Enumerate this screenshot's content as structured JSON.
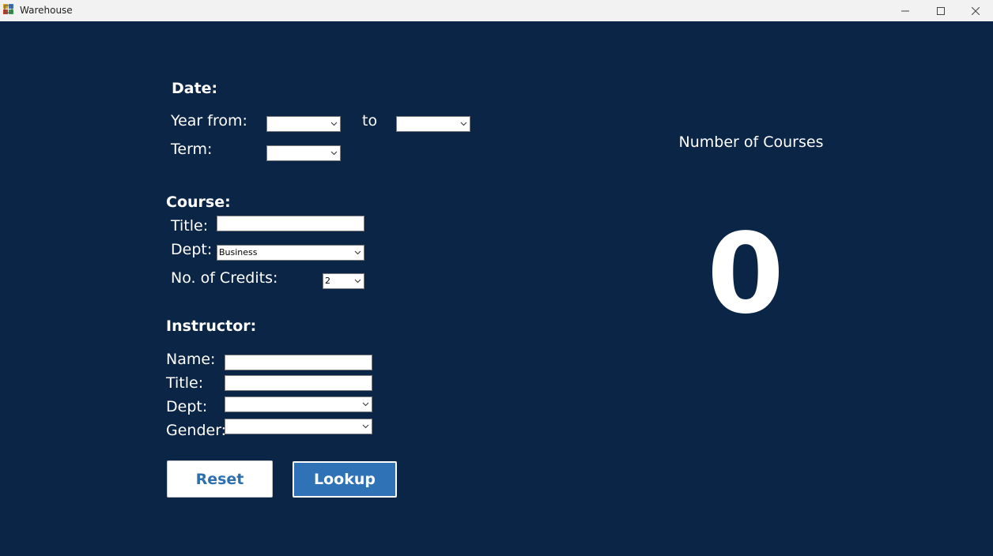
{
  "window": {
    "title": "Warehouse"
  },
  "date": {
    "section_label": "Date:",
    "year_from_label": "Year from:",
    "year_from_value": "",
    "to_label": "to",
    "year_to_value": "",
    "term_label": "Term:",
    "term_value": ""
  },
  "course": {
    "section_label": "Course:",
    "title_label": "Title:",
    "title_value": "",
    "dept_label": "Dept:",
    "dept_value": "Business",
    "credits_label": "No. of Credits:",
    "credits_value": "2"
  },
  "instructor": {
    "section_label": "Instructor:",
    "name_label": "Name:",
    "name_value": "",
    "title_label": "Title:",
    "title_value": "",
    "dept_label": "Dept:",
    "dept_value": "",
    "gender_label": "Gender:",
    "gender_value": ""
  },
  "buttons": {
    "reset_label": "Reset",
    "lookup_label": "Lookup"
  },
  "result": {
    "label": "Number of Courses",
    "count": "0"
  },
  "colors": {
    "background": "#0b2546",
    "accent": "#2f72b6",
    "titlebar": "#f2f2f2"
  },
  "icons": {
    "app": "warehouse-app-icon",
    "minimize": "minimize-icon",
    "maximize": "maximize-icon",
    "close": "close-icon",
    "dropdown": "chevron-down-icon"
  }
}
